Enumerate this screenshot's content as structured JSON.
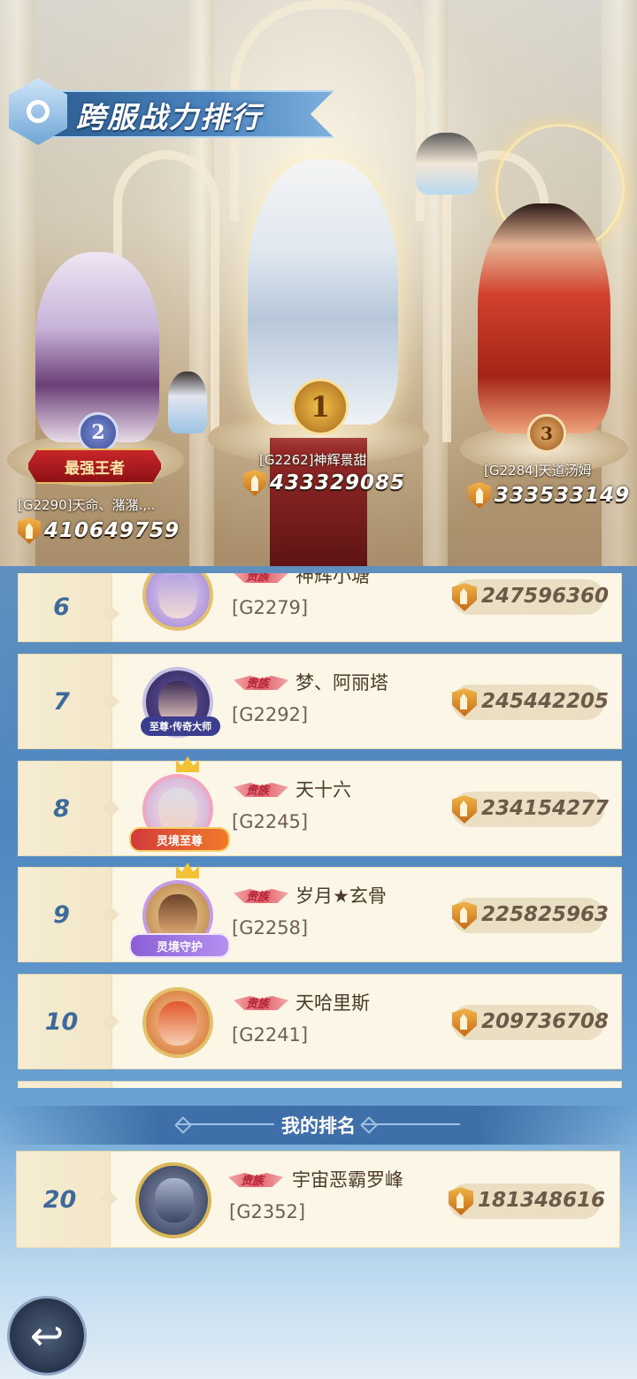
{
  "title": "跨服战力排行",
  "top3": [
    {
      "rank": "1",
      "name": "[G2262]神辉景甜",
      "power": "433329085"
    },
    {
      "rank": "2",
      "name": "[G2290]天命、潴潴.,..",
      "power": "410649759",
      "badge": "最强王者"
    },
    {
      "rank": "3",
      "name": "[G2284]天道汤姆",
      "power": "333533149"
    }
  ],
  "rows": [
    {
      "rank": "6",
      "name": "神辉小塘",
      "server": "[G2279]",
      "power": "247596360",
      "vip": "贵族"
    },
    {
      "rank": "7",
      "name": "梦、阿丽塔",
      "server": "[G2292]",
      "power": "245442205",
      "vip": "贵族",
      "avatar_tag": "至尊·传奇大师"
    },
    {
      "rank": "8",
      "name": "天十六",
      "server": "[G2245]",
      "power": "234154277",
      "vip": "贵族",
      "avatar_tag": "灵境至尊"
    },
    {
      "rank": "9",
      "name": "岁月★玄骨",
      "server": "[G2258]",
      "power": "225825963",
      "vip": "贵族",
      "avatar_tag": "灵境守护"
    },
    {
      "rank": "10",
      "name": "天哈里斯",
      "server": "[G2241]",
      "power": "209736708",
      "vip": "贵族"
    }
  ],
  "my_rank_title": "我的排名",
  "my_rank": {
    "rank": "20",
    "name": "宇宙恶霸罗峰",
    "server": "[G2352]",
    "power": "181348616",
    "vip": "贵族"
  },
  "icons": {
    "power": "shield-power-icon",
    "back": "back-arrow-icon"
  },
  "colors": {
    "rank_number": "#3e6a9a",
    "row_bg": "#fbf6e6",
    "banner": "#3e6fa8"
  }
}
